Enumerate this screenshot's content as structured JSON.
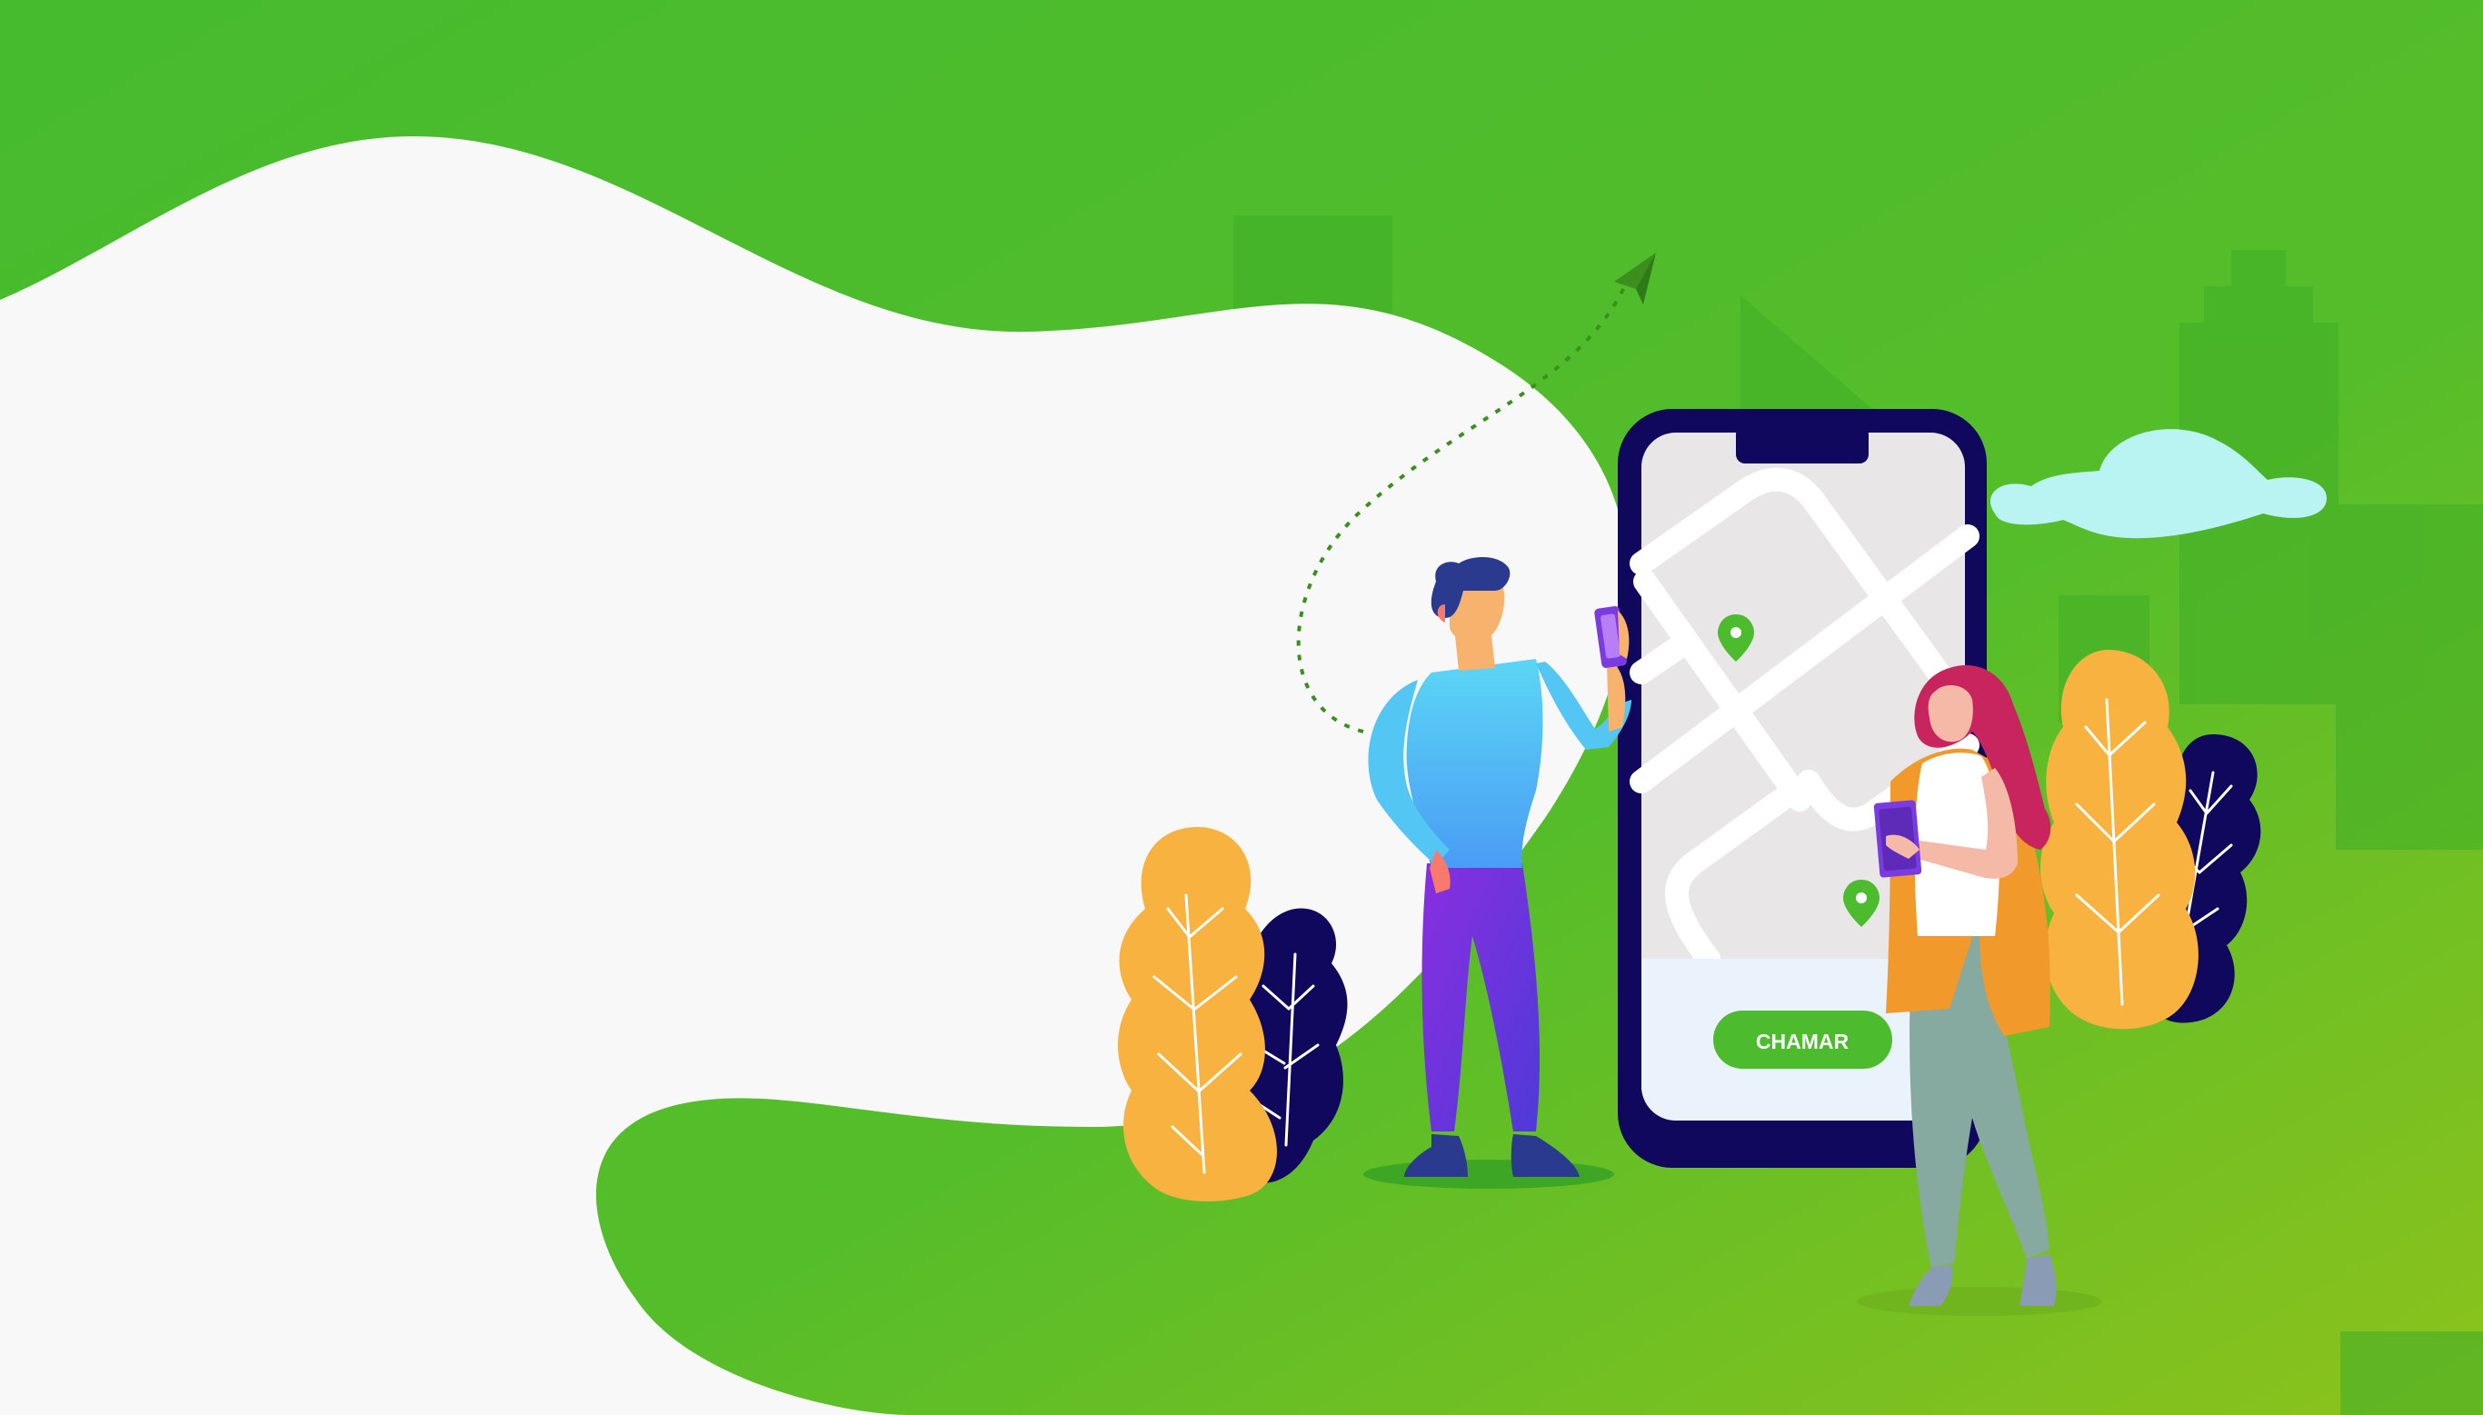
{
  "phone": {
    "call_button_label": "CHAMAR"
  },
  "colors": {
    "background_green_start": "#4cbc2e",
    "background_green_end": "#8cc21c",
    "blob_white": "#f8f8f8",
    "phone_frame": "#10085c",
    "map_bg": "#e8e6e6",
    "call_button": "#4cbc2e",
    "pin_green": "#4cbc2e",
    "cloud": "#b9f3f2",
    "bush_orange": "#f8b23f",
    "bush_navy": "#10085c"
  },
  "icons": [
    "paper-plane-icon",
    "map-pin-icon",
    "map-pin-icon"
  ]
}
